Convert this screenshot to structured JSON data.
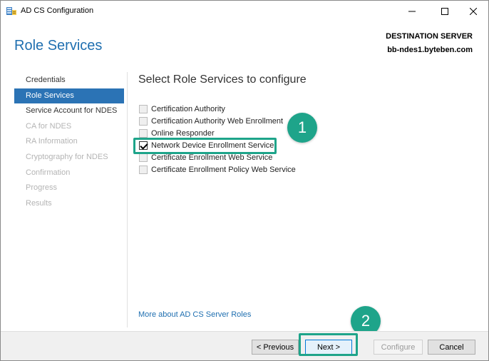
{
  "window": {
    "title": "AD CS Configuration",
    "icon": "ad-cs-config-icon",
    "controls": {
      "minimize": "—",
      "maximize": "☐",
      "close": "✕"
    }
  },
  "header": {
    "page_title": "Role Services",
    "destination_label": "DESTINATION SERVER",
    "destination_server": "bb-ndes1.byteben.com"
  },
  "sidebar": {
    "items": [
      {
        "label": "Credentials",
        "state": "enabled"
      },
      {
        "label": "Role Services",
        "state": "selected"
      },
      {
        "label": "Service Account for NDES",
        "state": "enabled"
      },
      {
        "label": "CA for NDES",
        "state": "disabled"
      },
      {
        "label": "RA Information",
        "state": "disabled"
      },
      {
        "label": "Cryptography for NDES",
        "state": "disabled"
      },
      {
        "label": "Confirmation",
        "state": "disabled"
      },
      {
        "label": "Progress",
        "state": "disabled"
      },
      {
        "label": "Results",
        "state": "disabled"
      }
    ]
  },
  "main": {
    "heading": "Select Role Services to configure",
    "services": [
      {
        "label": "Certification Authority",
        "checked": false
      },
      {
        "label": "Certification Authority Web Enrollment",
        "checked": false
      },
      {
        "label": "Online Responder",
        "checked": false
      },
      {
        "label": "Network Device Enrollment Service",
        "checked": true
      },
      {
        "label": "Certificate Enrollment Web Service",
        "checked": false
      },
      {
        "label": "Certificate Enrollment Policy Web Service",
        "checked": false
      }
    ],
    "more_link": "More about AD CS Server Roles"
  },
  "annotations": {
    "badge_1": "1",
    "badge_2": "2",
    "color": "#1ea48a"
  },
  "footer": {
    "previous": "< Previous",
    "next": "Next >",
    "configure": "Configure",
    "cancel": "Cancel"
  },
  "colors": {
    "accent": "#2b73b5",
    "title_blue": "#1f6fb0",
    "annotation_teal": "#1ea48a"
  }
}
